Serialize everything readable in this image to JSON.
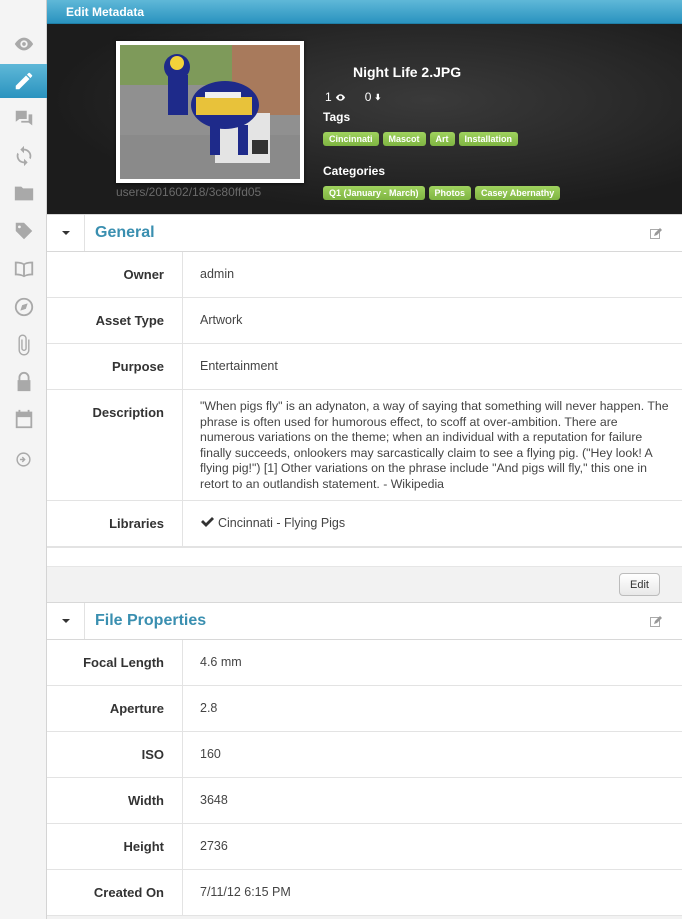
{
  "window": {
    "title": "Edit Metadata"
  },
  "sidebar": {
    "items": [
      {
        "icon": "eye-icon"
      },
      {
        "icon": "pencil-icon",
        "active": true
      },
      {
        "icon": "comments-icon"
      },
      {
        "icon": "sync-icon"
      },
      {
        "icon": "folder-icon"
      },
      {
        "icon": "tag-icon"
      },
      {
        "icon": "book-icon"
      },
      {
        "icon": "compass-icon"
      },
      {
        "icon": "paperclip-icon"
      },
      {
        "icon": "lock-icon"
      },
      {
        "icon": "calendar-icon"
      },
      {
        "icon": "arrow-right-circle-icon"
      }
    ]
  },
  "asset": {
    "file_name": "Night Life 2.JPG",
    "path": "users/201602/18/3c80ffd05",
    "views": "1",
    "downloads": "0",
    "tags_label": "Tags",
    "tags": [
      "Cincinnati",
      "Mascot",
      "Art",
      "Installation"
    ],
    "categories_label": "Categories",
    "categories": [
      "Q1 (January - March)",
      "Photos",
      "Casey Abernathy"
    ]
  },
  "general": {
    "title": "General",
    "owner_label": "Owner",
    "owner": "admin",
    "asset_type_label": "Asset Type",
    "asset_type": "Artwork",
    "purpose_label": "Purpose",
    "purpose": "Entertainment",
    "description_label": "Description",
    "description": "\"When pigs fly\" is an adynaton, a way of saying that something will never happen. The phrase is often used for humorous effect, to scoff at over-ambition. There are numerous variations on the theme; when an individual with a reputation for failure finally succeeds, onlookers may sarcastically claim to see a flying pig. (\"Hey look! A flying pig!\") [1] Other variations on the phrase include \"And pigs will fly,\" this one in retort to an outlandish statement. - Wikipedia",
    "libraries_label": "Libraries",
    "library": "Cincinnati - Flying Pigs",
    "edit_label": "Edit"
  },
  "file_properties": {
    "title": "File Properties",
    "focal_length_label": "Focal Length",
    "focal_length": "4.6 mm",
    "aperture_label": "Aperture",
    "aperture": "2.8",
    "iso_label": "ISO",
    "iso": "160",
    "width_label": "Width",
    "width": "3648",
    "height_label": "Height",
    "height": "2736",
    "created_on_label": "Created On",
    "created_on": "7/11/12 6:15 PM"
  },
  "colors": {
    "accent": "#2a93bf",
    "tag_green": "#8bc34a",
    "section_title": "#3a8fb0"
  }
}
